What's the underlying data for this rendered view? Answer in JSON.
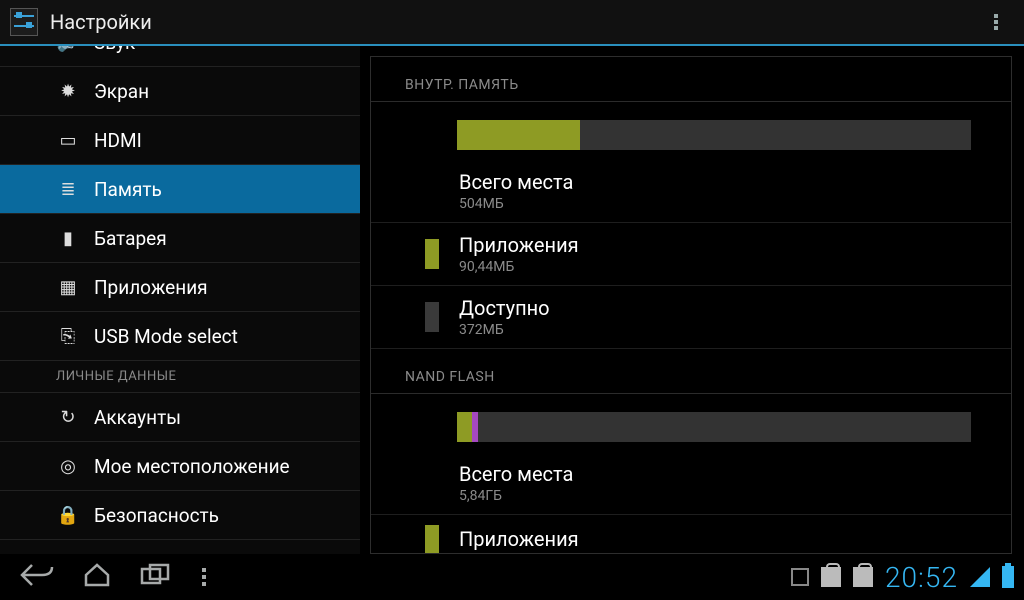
{
  "app": {
    "title": "Настройки"
  },
  "sidebar": {
    "items": [
      {
        "id": "sound",
        "label": "Звук"
      },
      {
        "id": "display",
        "label": "Экран"
      },
      {
        "id": "hdmi",
        "label": "HDMI"
      },
      {
        "id": "storage",
        "label": "Память",
        "selected": true
      },
      {
        "id": "battery",
        "label": "Батарея"
      },
      {
        "id": "apps",
        "label": "Приложения"
      },
      {
        "id": "usb-mode",
        "label": "USB Mode select"
      }
    ],
    "section2_header": "ЛИЧНЫЕ ДАННЫЕ",
    "items2": [
      {
        "id": "accounts",
        "label": "Аккаунты"
      },
      {
        "id": "location",
        "label": "Мое местоположение"
      },
      {
        "id": "security",
        "label": "Безопасность"
      }
    ]
  },
  "storage": {
    "sections": [
      {
        "title": "ВНУТР. ПАМЯТЬ",
        "bar": {
          "segments": [
            {
              "color": "#8e9b24",
              "pct": 24
            }
          ]
        },
        "rows": [
          {
            "swatch": "none",
            "title": "Всего места",
            "sub": "504МБ"
          },
          {
            "swatch": "#8e9b24",
            "title": "Приложения",
            "sub": "90,44МБ"
          },
          {
            "swatch": "#3a3a3a",
            "title": "Доступно",
            "sub": "372МБ"
          }
        ]
      },
      {
        "title": "NAND FLASH",
        "bar": {
          "segments": [
            {
              "color": "#8e9b24",
              "pct": 3
            },
            {
              "color": "#a548c0",
              "pct": 1
            }
          ]
        },
        "rows": [
          {
            "swatch": "none",
            "title": "Всего места",
            "sub": "5,84ГБ"
          },
          {
            "swatch": "#8e9b24",
            "title": "Приложения",
            "sub": ""
          }
        ]
      }
    ]
  },
  "statusbar": {
    "clock": "20:52"
  },
  "icons": {
    "sound": "🔊",
    "display": "✹",
    "hdmi": "▭",
    "storage": "≣",
    "battery": "▮",
    "apps": "▦",
    "usb-mode": "⎘",
    "accounts": "↻",
    "location": "◎",
    "security": "🔒"
  }
}
